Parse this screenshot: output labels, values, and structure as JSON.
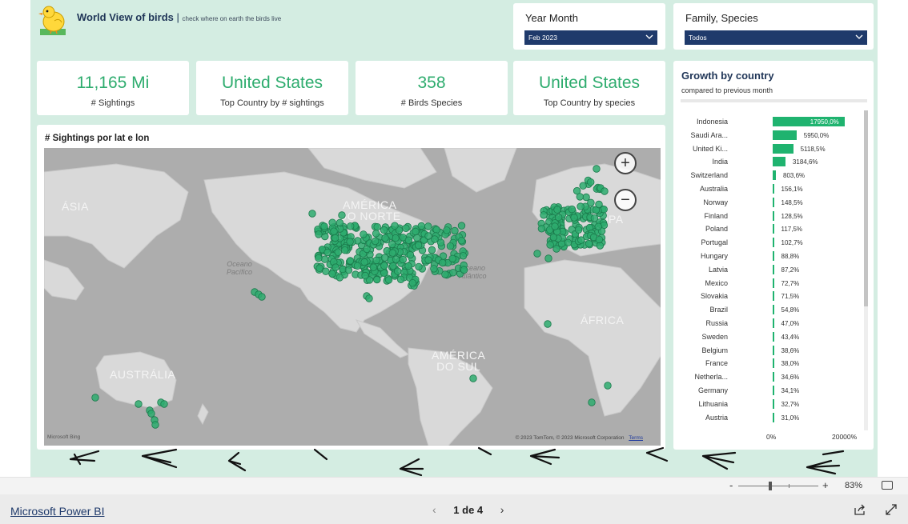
{
  "header": {
    "title": "World View of birds",
    "separator": "|",
    "subtitle": "check where on earth the birds live",
    "logo_icon": "chick-icon"
  },
  "slicers": {
    "year_month": {
      "label": "Year Month",
      "value": "Feb 2023"
    },
    "family_species": {
      "label": "Family, Species",
      "value": "Todos"
    }
  },
  "kpis": [
    {
      "value": "11,165 Mi",
      "label": "# Sightings"
    },
    {
      "value": "United States",
      "label": "Top Country by # sightings"
    },
    {
      "value": "358",
      "label": "# Birds Species"
    },
    {
      "value": "United States",
      "label": "Top Country by species"
    }
  ],
  "map": {
    "title": "# Sightings por lat e lon",
    "labels": {
      "asia": "ÁSIA",
      "north_america": [
        "AMÉRICA",
        "DO NORTE"
      ],
      "europe": "ROPA",
      "africa": "ÁFRICA",
      "south_america": [
        "AMÉRICA",
        "DO SUL"
      ],
      "australia": "AUSTRÁLIA",
      "pacific": [
        "Oceano",
        "Pacífico"
      ],
      "atlantic": [
        "Oceano",
        "Atlântico"
      ]
    },
    "credit": "© 2023 TomTom, © 2023 Microsoft Corporation",
    "terms": "Terms",
    "provider": "Microsoft Bing",
    "zoom_in": "+",
    "zoom_out": "−",
    "point_color": "#2eac6e"
  },
  "growth": {
    "title": "Growth by country",
    "subtitle": "compared to previous month",
    "axis": {
      "min_label": "0%",
      "max_label": "20000%"
    },
    "bar_color": "#1fb36f",
    "rows": [
      {
        "country": "Indonesia",
        "pct": 17950.0,
        "label": "17950,0%"
      },
      {
        "country": "Saudi Ara...",
        "pct": 5950.0,
        "label": "5950,0%"
      },
      {
        "country": "United Ki...",
        "pct": 5118.5,
        "label": "5118,5%"
      },
      {
        "country": "India",
        "pct": 3184.6,
        "label": "3184,6%"
      },
      {
        "country": "Switzerland",
        "pct": 803.6,
        "label": "803,6%"
      },
      {
        "country": "Australia",
        "pct": 156.1,
        "label": "156,1%"
      },
      {
        "country": "Norway",
        "pct": 148.5,
        "label": "148,5%"
      },
      {
        "country": "Finland",
        "pct": 128.5,
        "label": "128,5%"
      },
      {
        "country": "Poland",
        "pct": 117.5,
        "label": "117,5%"
      },
      {
        "country": "Portugal",
        "pct": 102.7,
        "label": "102,7%"
      },
      {
        "country": "Hungary",
        "pct": 88.8,
        "label": "88,8%"
      },
      {
        "country": "Latvia",
        "pct": 87.2,
        "label": "87,2%"
      },
      {
        "country": "Mexico",
        "pct": 72.7,
        "label": "72,7%"
      },
      {
        "country": "Slovakia",
        "pct": 71.5,
        "label": "71,5%"
      },
      {
        "country": "Brazil",
        "pct": 54.8,
        "label": "54,8%"
      },
      {
        "country": "Russia",
        "pct": 47.0,
        "label": "47,0%"
      },
      {
        "country": "Sweden",
        "pct": 43.4,
        "label": "43,4%"
      },
      {
        "country": "Belgium",
        "pct": 38.6,
        "label": "38,6%"
      },
      {
        "country": "France",
        "pct": 38.0,
        "label": "38,0%"
      },
      {
        "country": "Netherla...",
        "pct": 34.6,
        "label": "34,6%"
      },
      {
        "country": "Germany",
        "pct": 34.1,
        "label": "34,1%"
      },
      {
        "country": "Lithuania",
        "pct": 32.7,
        "label": "32,7%"
      },
      {
        "country": "Austria",
        "pct": 31.0,
        "label": "31,0%"
      }
    ]
  },
  "zoom_bar": {
    "minus": "-",
    "plus": "+",
    "zoom_pct": "83%",
    "level": 0.83
  },
  "footer": {
    "brand_link": "Microsoft Power BI",
    "page_indicator": "1 de 4",
    "prev": "‹",
    "next": "›"
  }
}
